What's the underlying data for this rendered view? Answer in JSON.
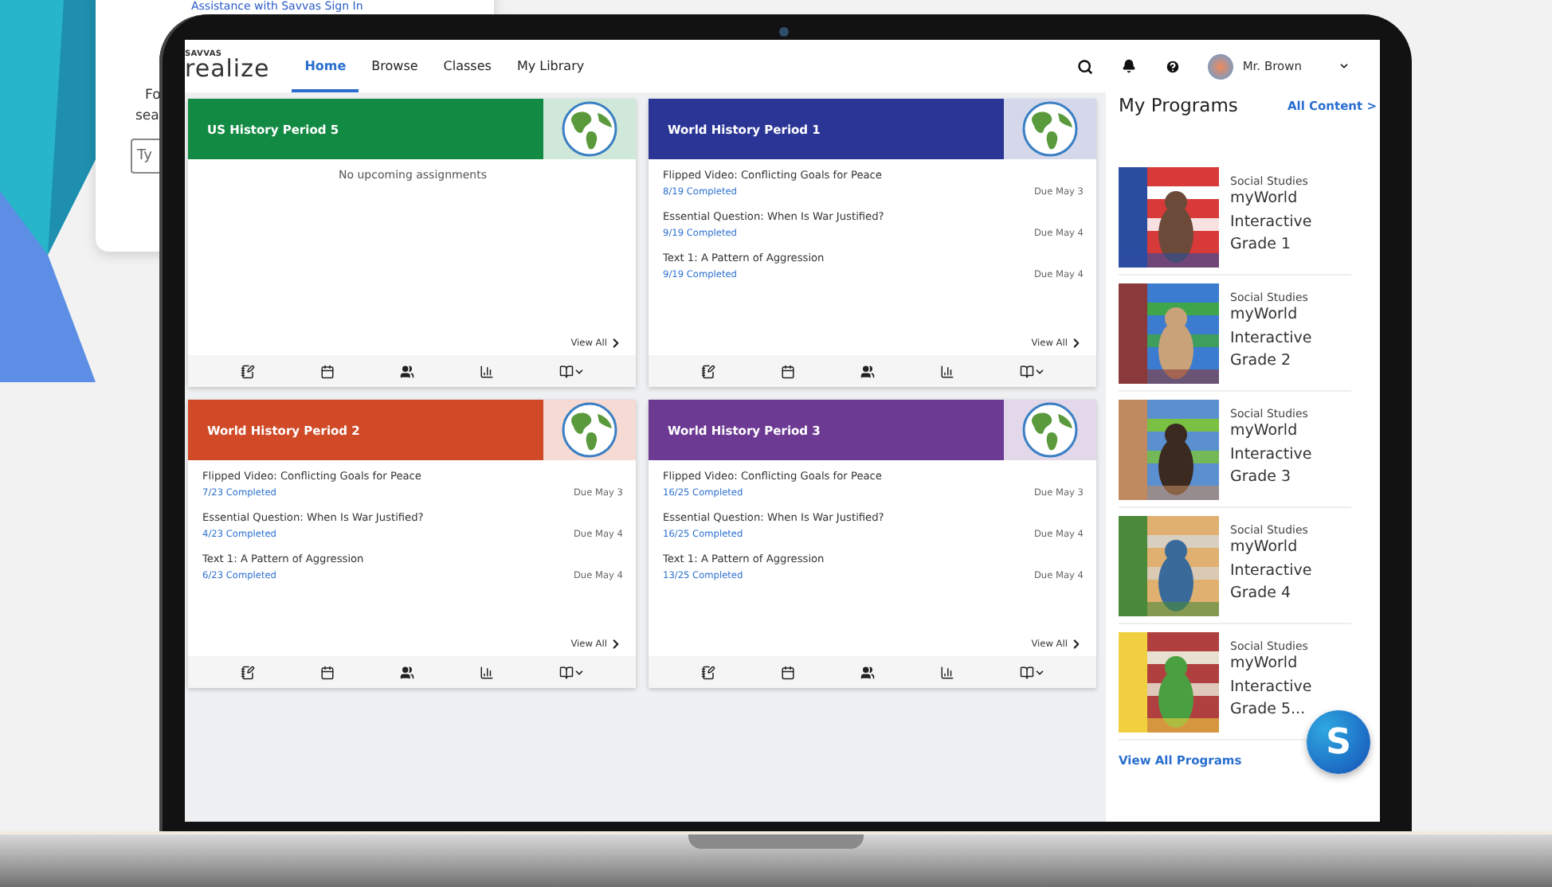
{
  "background_window": {
    "link": "Assistance with Savvas Sign In",
    "texts": [
      "Fo",
      "sea"
    ],
    "field": {
      "placeholder": "Ty"
    }
  },
  "nav": {
    "logo_top": "SAVVAS",
    "logo": "realize",
    "tabs": [
      {
        "label": "Home",
        "selected": true
      },
      {
        "label": "Browse",
        "selected": false
      },
      {
        "label": "Classes",
        "selected": false
      },
      {
        "label": "My Library",
        "selected": false
      }
    ],
    "user": "Mr. Brown"
  },
  "classes": [
    {
      "title": "US History Period 5",
      "color": "#138a43",
      "empty_message": "No upcoming assignments",
      "view_all": "View All"
    },
    {
      "title": "World History Period 1",
      "color": "#2b3595",
      "assignments": [
        {
          "title": "Flipped Video: Conflicting Goals for Peace",
          "progress": "8/19 Completed",
          "due": "Due May 3"
        },
        {
          "title": "Essential Question: When Is War Justified?",
          "progress": "9/19 Completed",
          "due": "Due May 4"
        },
        {
          "title": "Text 1: A Pattern of Aggression",
          "progress": "9/19 Completed",
          "due": "Due May 4"
        }
      ],
      "view_all": "View All"
    },
    {
      "title": "World History Period 2",
      "color": "#d04a27",
      "assignments": [
        {
          "title": "Flipped Video: Conflicting Goals for Peace",
          "progress": "7/23 Completed",
          "due": "Due May 3"
        },
        {
          "title": "Essential Question: When Is War Justified?",
          "progress": "4/23 Completed",
          "due": "Due May 4"
        },
        {
          "title": "Text 1: A Pattern of Aggression",
          "progress": "6/23 Completed",
          "due": "Due May 4"
        }
      ],
      "view_all": "View All"
    },
    {
      "title": "World History Period 3",
      "color": "#6c3a93",
      "assignments": [
        {
          "title": "Flipped Video: Conflicting Goals for Peace",
          "progress": "16/25 Completed",
          "due": "Due May 3"
        },
        {
          "title": "Essential Question: When Is War Justified?",
          "progress": "16/25 Completed",
          "due": "Due May 4"
        },
        {
          "title": "Text 1: A Pattern of Aggression",
          "progress": "13/25 Completed",
          "due": "Due May 4"
        }
      ],
      "view_all": "View All"
    }
  ],
  "programs": {
    "title": "My Programs",
    "link": "All Content >",
    "items": [
      {
        "subject": "Social Studies",
        "name": "myWorld Interactive Grade 1"
      },
      {
        "subject": "Social Studies",
        "name": "myWorld Interactive Grade 2"
      },
      {
        "subject": "Social Studies",
        "name": "myWorld Interactive Grade 3"
      },
      {
        "subject": "Social Studies",
        "name": "myWorld Interactive Grade 4"
      },
      {
        "subject": "Social Studies",
        "name": "myWorld Interactive Grade 5..."
      }
    ],
    "view_all": "View All Programs"
  },
  "chat_button": "S"
}
